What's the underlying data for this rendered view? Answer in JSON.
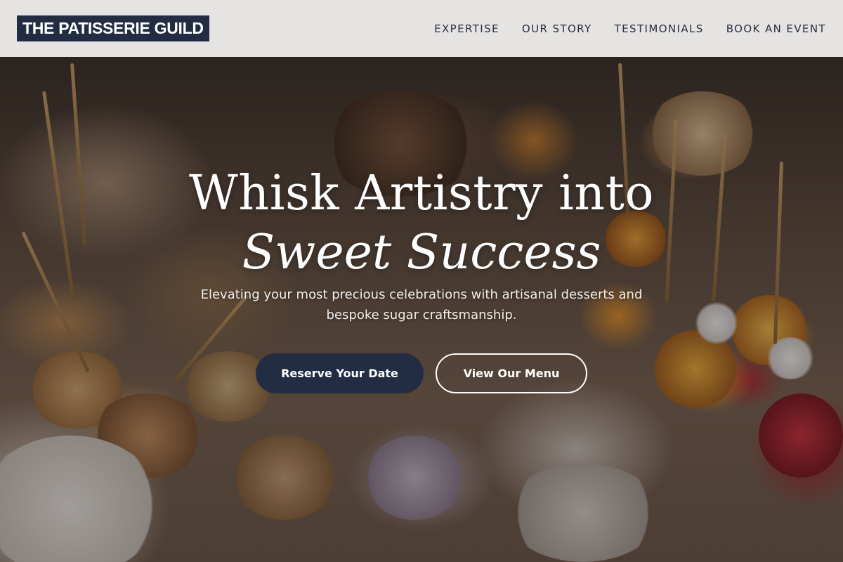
{
  "header": {
    "logo_text": "THE PATISSERIE GUILD",
    "nav": [
      {
        "label": "EXPERTISE"
      },
      {
        "label": "OUR STORY"
      },
      {
        "label": "TESTIMONIALS"
      },
      {
        "label": "BOOK AN EVENT"
      }
    ]
  },
  "hero": {
    "headline_line1": "Whisk Artistry into",
    "headline_line2": "Sweet Success",
    "subtext": "Elevating your most precious celebrations with artisanal desserts and bespoke sugar craftsmanship.",
    "primary_button": "Reserve Your Date",
    "secondary_button": "View Our Menu",
    "background_image": "dessert-table-photo"
  },
  "colors": {
    "brand_navy": "#222d44",
    "header_bg": "#f4f3f2",
    "text_white": "#ffffff"
  }
}
